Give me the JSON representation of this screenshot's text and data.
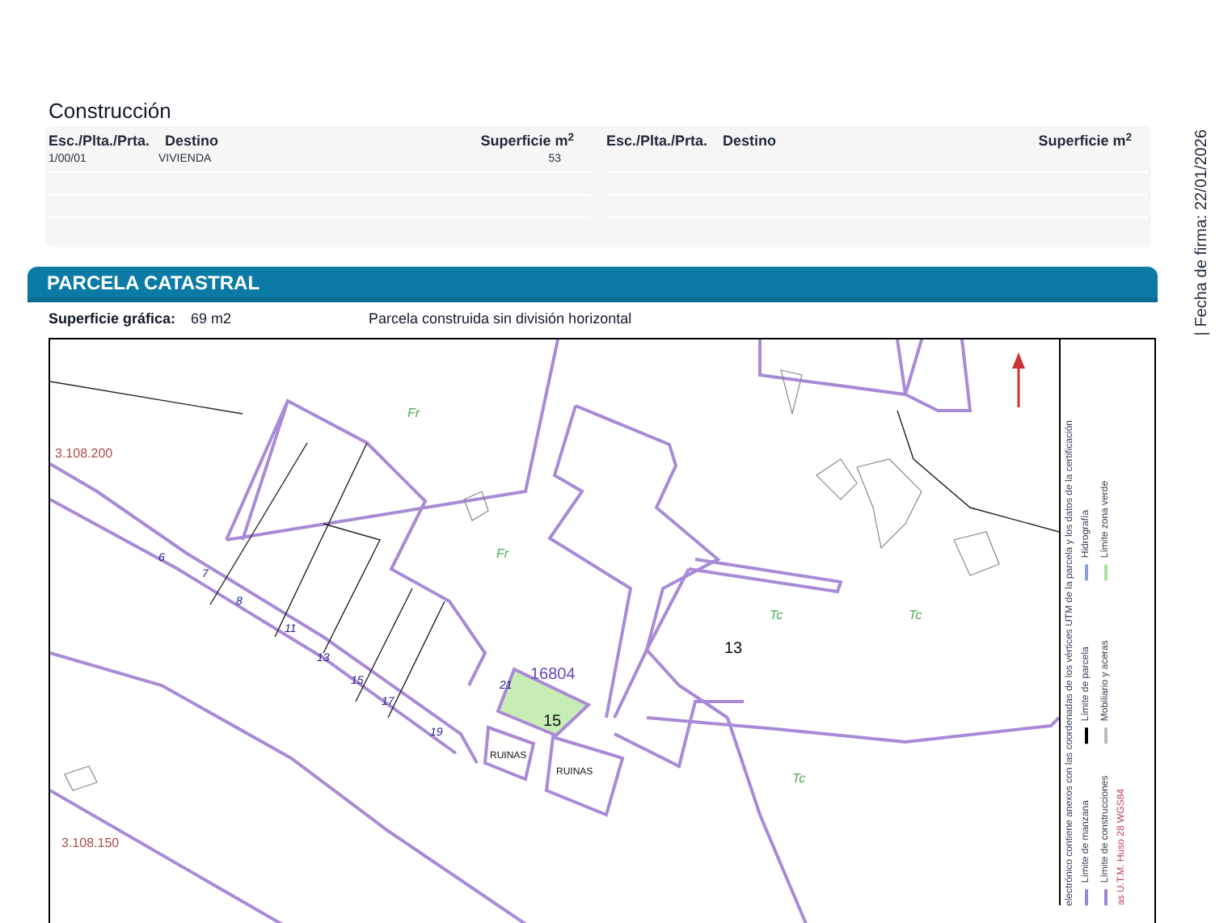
{
  "construccion": {
    "title": "Construcción",
    "columns": [
      {
        "label": "Esc./Plta./Prta."
      },
      {
        "label": "Destino"
      },
      {
        "label": "Superficie m$^{2}$"
      },
      {
        "label": "Esc./Plta./Prta."
      },
      {
        "label": "Destino"
      },
      {
        "label": "Superficie m$^{2}$"
      }
    ],
    "rows": [
      [
        "1/00/01",
        "VIVIENDA",
        "53"
      ]
    ]
  },
  "parcela": {
    "title": "PARCELA CATASTRAL",
    "surface_label": "Superficie gráfica:",
    "surface_value": "69 m2",
    "note": "Parcela construida sin división horizontal"
  },
  "map": {
    "labels": [
      {
        "text": "3.108.200",
        "kind": "coord"
      },
      {
        "text": "3.108.150",
        "kind": "coord"
      },
      {
        "text": "Fr",
        "kind": "zone"
      },
      {
        "text": "Fr",
        "kind": "zone"
      },
      {
        "text": "Tc",
        "kind": "zone"
      },
      {
        "text": "Tc",
        "kind": "zone"
      },
      {
        "text": "Tc",
        "kind": "zone"
      },
      {
        "text": "13",
        "kind": "number"
      },
      {
        "text": "16804",
        "kind": "parcel"
      },
      {
        "text": "15",
        "kind": "number"
      },
      {
        "text": "RUINAS",
        "kind": "ruin"
      },
      {
        "text": "RUINAS",
        "kind": "ruin"
      },
      {
        "text": "6",
        "kind": "street"
      },
      {
        "text": "7",
        "kind": "street"
      },
      {
        "text": "8",
        "kind": "street"
      },
      {
        "text": "11",
        "kind": "street"
      },
      {
        "text": "13",
        "kind": "street"
      },
      {
        "text": "15",
        "kind": "street"
      },
      {
        "text": "17",
        "kind": "street"
      },
      {
        "text": "19",
        "kind": "street"
      },
      {
        "text": "21",
        "kind": "street"
      }
    ],
    "legend": {
      "items": [
        {
          "label": "Límite de manzana",
          "color": "#9b86d6"
        },
        {
          "label": "Límite de parcela",
          "color": "#000000"
        },
        {
          "label": "Hidrografía",
          "color": "#8aa0e0"
        },
        {
          "label": "Límite de construcciones",
          "color": "#9b86d6"
        },
        {
          "label": "Mobiliario y aceras",
          "color": "#bbbbbb"
        },
        {
          "label": "Límite zona verde",
          "color": "#a8e0a0"
        }
      ],
      "coords_note": "as U.T.M. Huso 28 WGS84",
      "footnote": "electrónico contiene anexos con las coordenadas de los vértices UTM de la parcela y los datos de la certificación"
    }
  },
  "side_note": "| Fecha de firma: 22/01/2026"
}
